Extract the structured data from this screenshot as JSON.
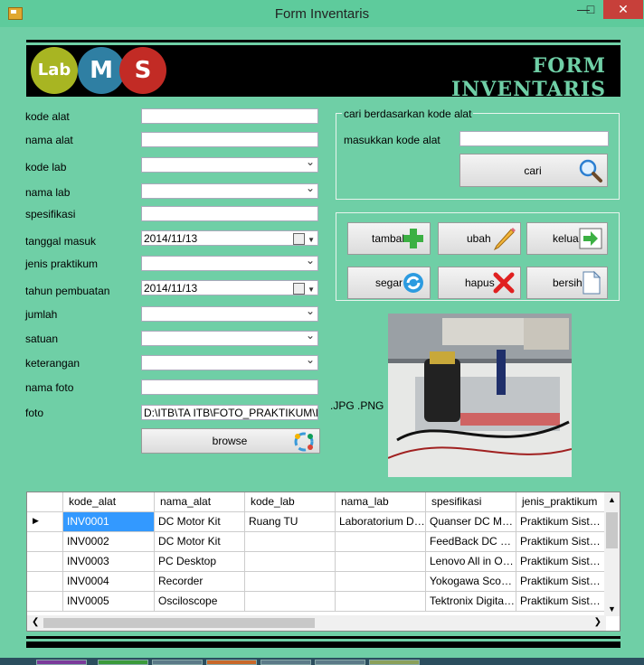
{
  "window": {
    "title": "Form Inventaris"
  },
  "header": {
    "logo_lab": "Lab",
    "logo_m": "M",
    "logo_s": "S",
    "title": "FORM INVENTARIS"
  },
  "form": {
    "labels": {
      "kode_alat": "kode alat",
      "nama_alat": "nama alat",
      "kode_lab": "kode lab",
      "nama_lab": "nama lab",
      "spesifikasi": "spesifikasi",
      "tanggal_masuk": "tanggal masuk",
      "jenis_praktikum": "jenis praktikum",
      "tahun_pembuatan": "tahun pembuatan",
      "jumlah": "jumlah",
      "satuan": "satuan",
      "keterangan": "keterangan",
      "nama_foto": "nama foto",
      "foto": "foto"
    },
    "values": {
      "tanggal_masuk": "2014/11/13",
      "tahun_pembuatan": "2014/11/13",
      "foto": "D:\\ITB\\TA ITB\\FOTO_PRAKTIKUM\\Ins"
    },
    "browse_label": "browse",
    "file_types": ".JPG  .PNG"
  },
  "search": {
    "group_title": "cari berdasarkan kode alat",
    "label": "masukkan kode alat",
    "button": "cari"
  },
  "actions": {
    "tambah": "tambah",
    "ubah": "ubah",
    "keluar": "keluar",
    "segar": "segar",
    "hapus": "hapus",
    "bersih": "bersih"
  },
  "grid": {
    "columns": [
      "kode_alat",
      "nama_alat",
      "kode_lab",
      "nama_lab",
      "spesifikasi",
      "jenis_praktikum"
    ],
    "rows": [
      [
        "INV0001",
        "DC Motor Kit",
        "Ruang TU",
        "Laboratorium Das...",
        "Quanser DC Mot...",
        "Praktikum Sistem..."
      ],
      [
        "INV0002",
        "DC Motor Kit",
        "",
        "",
        "FeedBack DC M...",
        "Praktikum Sistem..."
      ],
      [
        "INV0003",
        "PC Desktop",
        "",
        "",
        "Lenovo All in On...",
        "Praktikum Sistem..."
      ],
      [
        "INV0004",
        "Recorder",
        "",
        "",
        "Yokogawa Scop...",
        "Praktikum Sistem..."
      ],
      [
        "INV0005",
        "Osciloscope",
        "",
        "",
        "Tektronix Digital ...",
        "Praktikum Sistem..."
      ]
    ]
  },
  "icons": {
    "search": "magnifier-icon",
    "add": "plus-icon",
    "edit": "pencil-icon",
    "exit": "arrow-right-icon",
    "refresh": "refresh-icon",
    "delete": "x-icon",
    "clear": "document-icon"
  },
  "colors": {
    "background": "#6fcfa6",
    "banner": "#000000",
    "selection": "#3399ff",
    "close": "#c7403a"
  }
}
